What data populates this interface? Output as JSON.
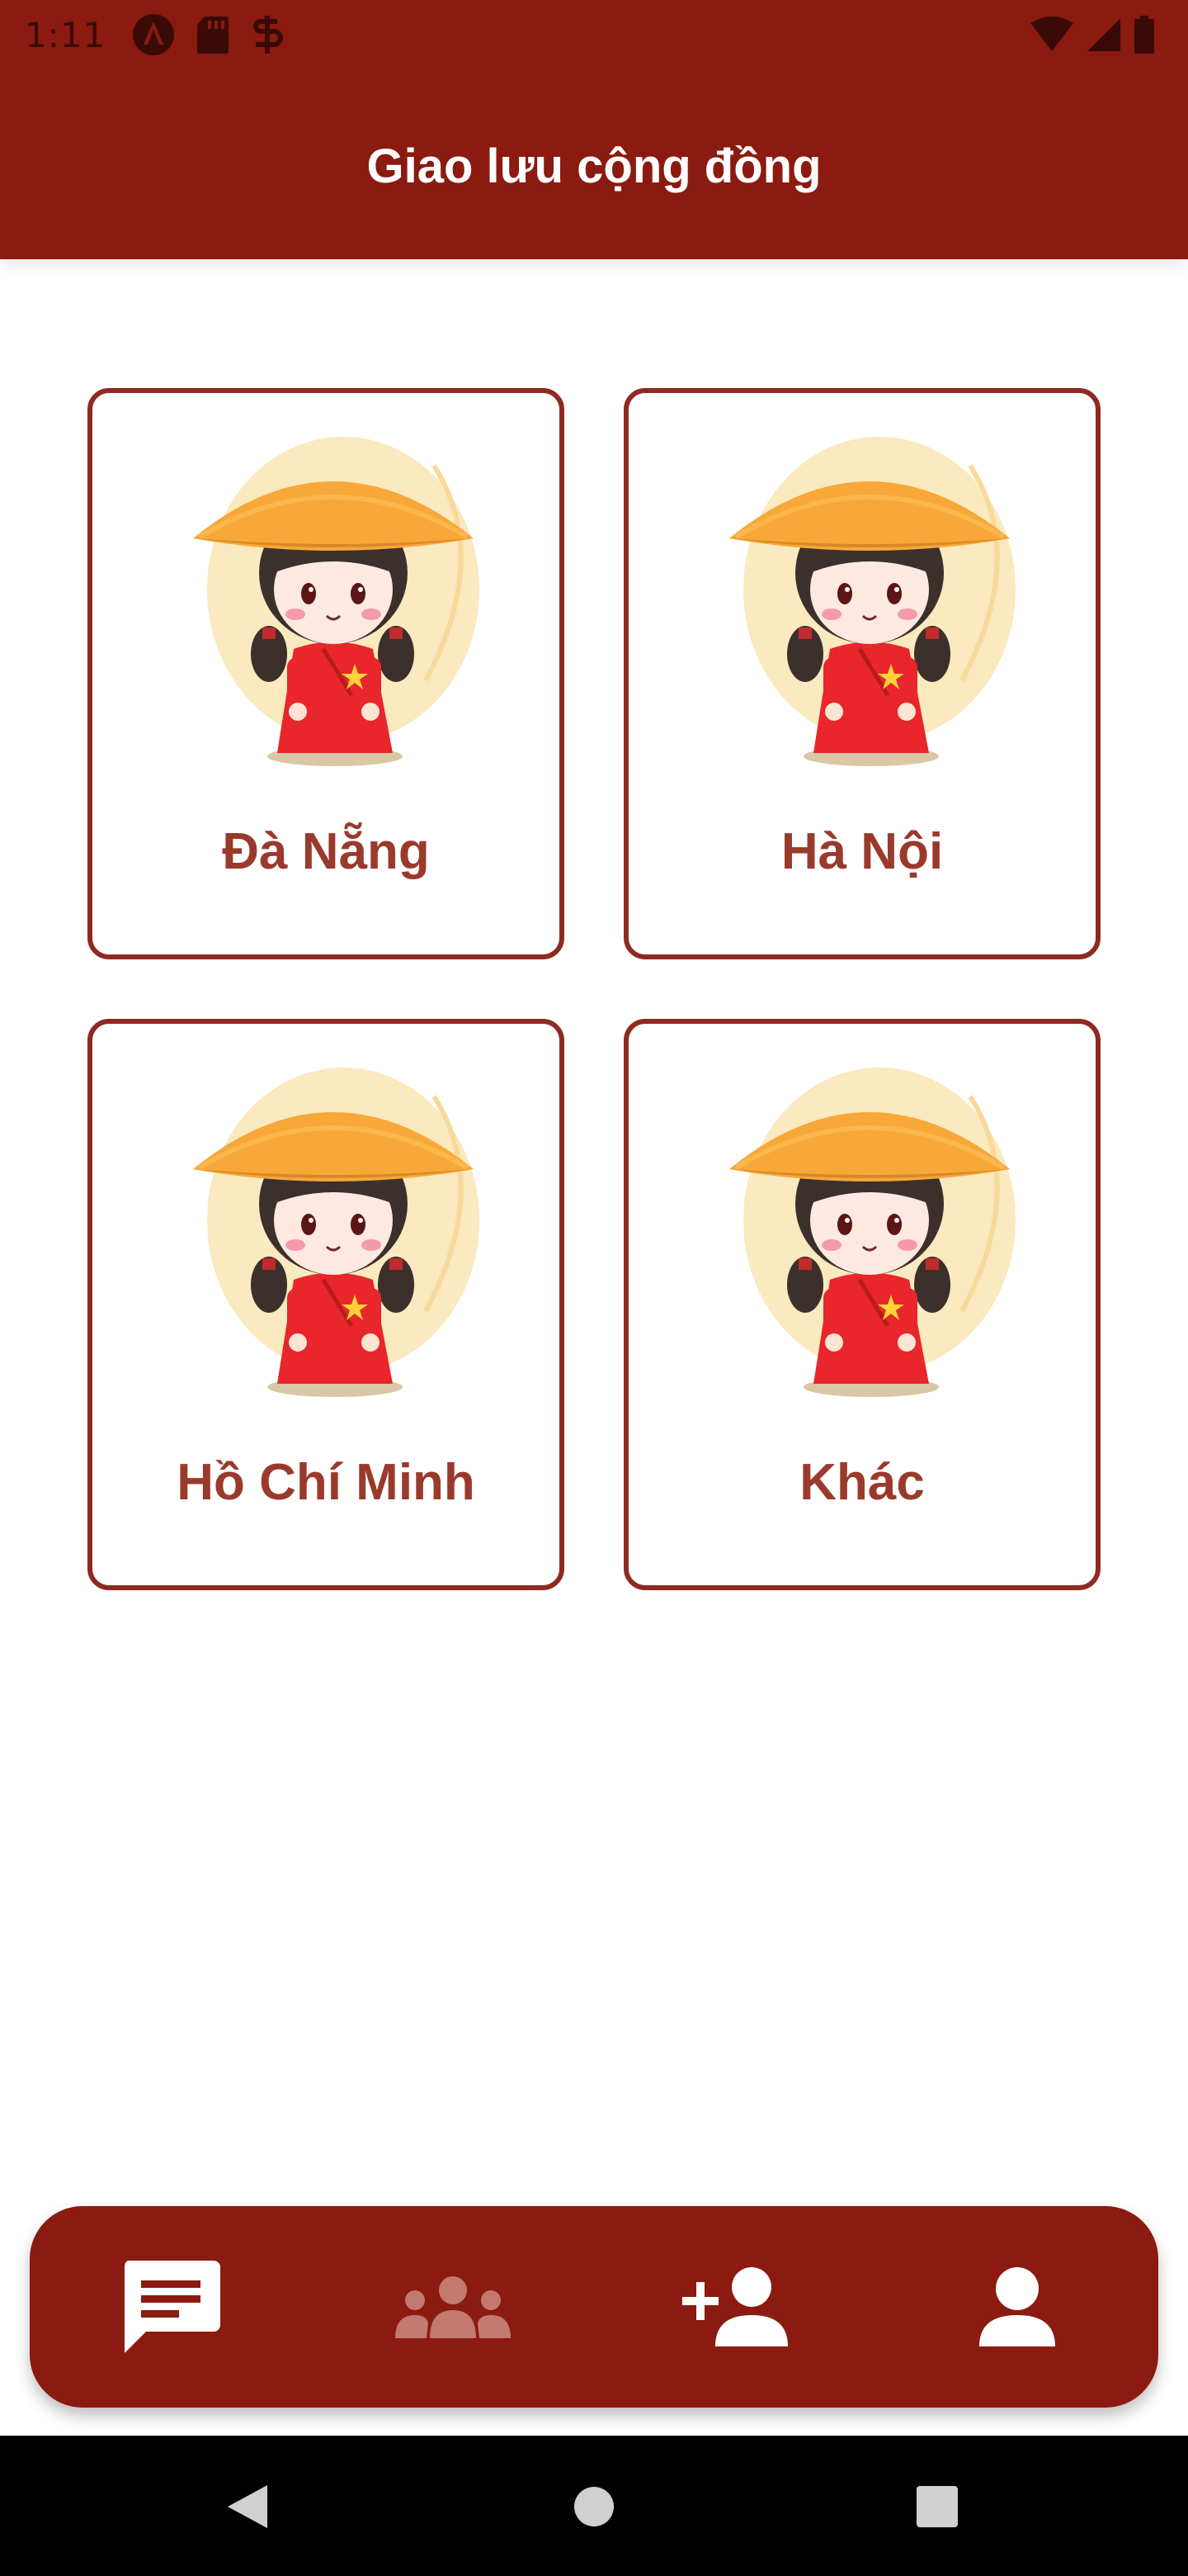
{
  "status_bar": {
    "time": "1:11",
    "left_icons": [
      "angular-icon",
      "sd-card-icon",
      "s-app-icon"
    ],
    "right_icons": [
      "wifi-icon",
      "cell-signal-icon",
      "battery-icon"
    ]
  },
  "app_bar": {
    "title": "Giao lưu cộng đồng"
  },
  "regions": [
    {
      "label": "Đà Nẵng",
      "image": "vietnamese-girl-mascot"
    },
    {
      "label": "Hà Nội",
      "image": "vietnamese-girl-mascot"
    },
    {
      "label": "Hồ Chí Minh",
      "image": "vietnamese-girl-mascot"
    },
    {
      "label": "Khác",
      "image": "vietnamese-girl-mascot"
    }
  ],
  "bottom_nav": {
    "items": [
      {
        "icon": "chat-icon",
        "active": true
      },
      {
        "icon": "groups-icon",
        "active": false
      },
      {
        "icon": "add-friend-icon",
        "active": false
      },
      {
        "icon": "profile-icon",
        "active": false
      }
    ]
  },
  "system_nav": {
    "buttons": [
      "back-icon",
      "home-icon",
      "recents-icon"
    ]
  },
  "colors": {
    "primary": "#8b1a10",
    "card_border": "#8e2a22",
    "card_label": "#9a3a2c",
    "nav_inactive": "#c27a70",
    "background": "#ffffff"
  }
}
